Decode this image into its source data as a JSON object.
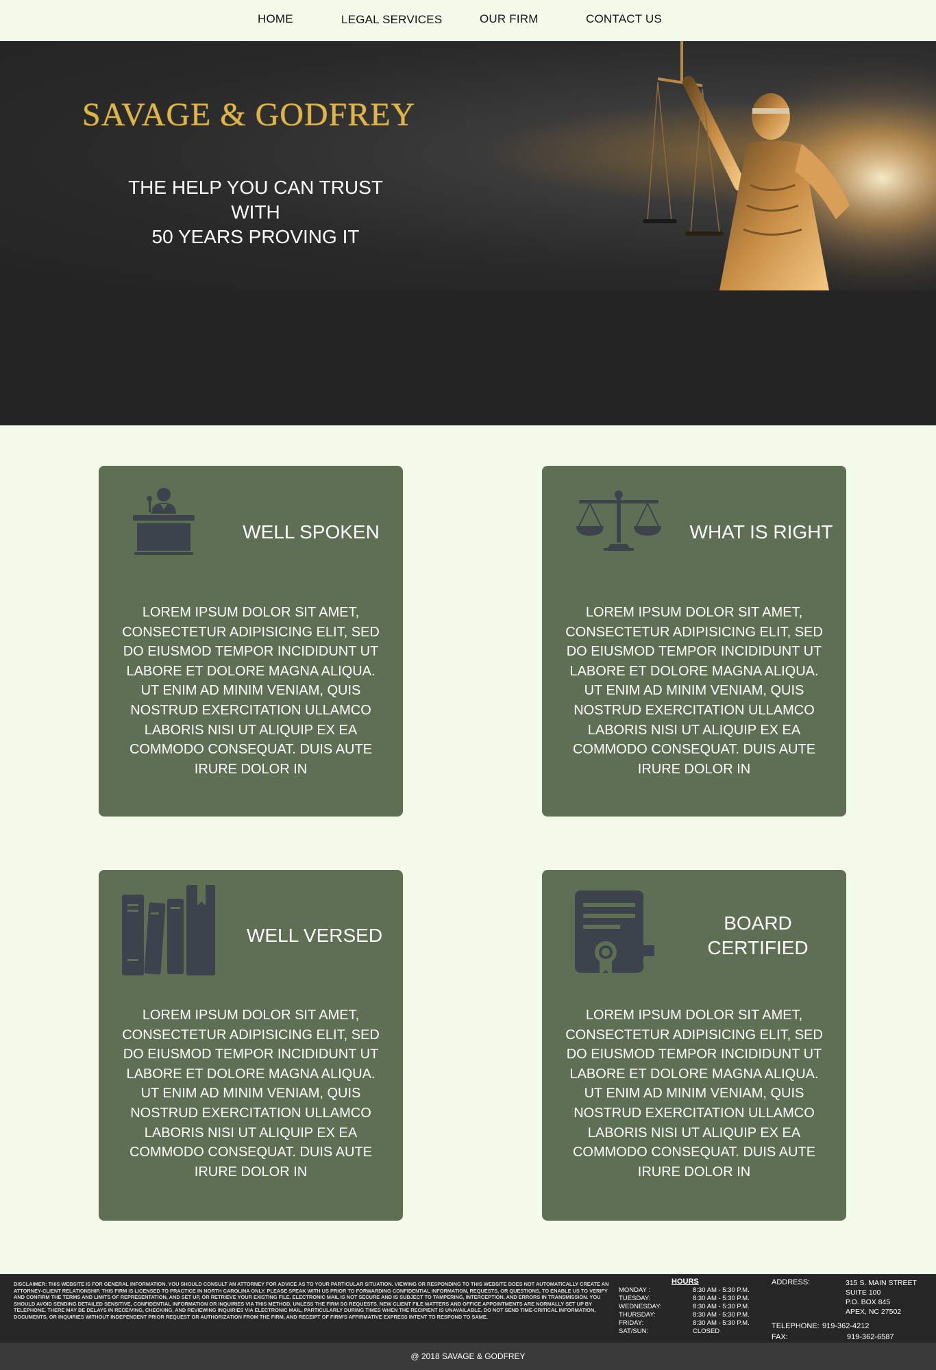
{
  "nav": {
    "home": "HOME",
    "legal_services": "LEGAL SERVICES",
    "our_firm": "OUR FIRM",
    "contact_us": "CONTACT US"
  },
  "hero": {
    "brand": "SAVAGE & GODFREY",
    "tagline_line1": "THE HELP YOU CAN TRUST",
    "tagline_line2": "WITH",
    "tagline_line3": "50 YEARS PROVING IT"
  },
  "cards": [
    {
      "title": "WELL SPOKEN",
      "icon": "podium-speaker-icon",
      "body": "LOREM IPSUM DOLOR SIT AMET, CONSECTETUR ADIPISICING ELIT, SED DO EIUSMOD TEMPOR INCIDIDUNT UT LABORE ET DOLORE MAGNA ALIQUA. UT ENIM AD MINIM VENIAM, QUIS NOSTRUD EXERCITATION ULLAMCO LABORIS NISI UT ALIQUIP EX EA COMMODO CONSEQUAT. DUIS AUTE IRURE DOLOR IN"
    },
    {
      "title": "WHAT IS RIGHT",
      "icon": "scales-icon",
      "body": "LOREM IPSUM DOLOR SIT AMET, CONSECTETUR ADIPISICING ELIT, SED DO EIUSMOD TEMPOR INCIDIDUNT UT LABORE ET DOLORE MAGNA ALIQUA. UT ENIM AD MINIM VENIAM, QUIS NOSTRUD EXERCITATION ULLAMCO LABORIS NISI UT ALIQUIP EX EA COMMODO CONSEQUAT. DUIS AUTE IRURE DOLOR IN"
    },
    {
      "title": "WELL VERSED",
      "icon": "books-icon",
      "body": "LOREM IPSUM DOLOR SIT AMET, CONSECTETUR ADIPISICING ELIT, SED DO EIUSMOD TEMPOR INCIDIDUNT UT LABORE ET DOLORE MAGNA ALIQUA. UT ENIM AD MINIM VENIAM, QUIS NOSTRUD EXERCITATION ULLAMCO LABORIS NISI UT ALIQUIP EX EA COMMODO CONSEQUAT. DUIS AUTE IRURE DOLOR IN"
    },
    {
      "title_line1": "BOARD",
      "title_line2": "CERTIFIED",
      "icon": "certificate-icon",
      "body": "LOREM IPSUM DOLOR SIT AMET, CONSECTETUR ADIPISICING ELIT, SED DO EIUSMOD TEMPOR INCIDIDUNT UT LABORE ET DOLORE MAGNA ALIQUA. UT ENIM AD MINIM VENIAM, QUIS NOSTRUD EXERCITATION ULLAMCO LABORIS NISI UT ALIQUIP EX EA COMMODO CONSEQUAT. DUIS AUTE IRURE DOLOR IN"
    }
  ],
  "footer": {
    "disclaimer": "DISCLAIMER: THIS WEBSITE IS FOR GENERAL INFORMATION. YOU SHOULD CONSULT AN ATTORNEY FOR ADVICE AS TO YOUR PARTICULAR SITUATION. VIEWING OR RESPONDING TO THIS WEBSITE DOES NOT AUTOMATICALLY CREATE AN ATTORNEY-CLIENT RELATIONSHIP. THIS FIRM IS LICENSED TO PRACTICE IN NORTH CAROLINA ONLY. PLEASE SPEAK WITH US PRIOR TO FORWARDING CONFIDENTIAL INFORMATION, REQUESTS, OR QUESTIONS, TO ENABLE US TO VERIFY AND CONFIRM THE TERMS AND LIMITS OF REPRESENTATION, AND SET UP, OR RETRIEVE YOUR EXISTING FILE. ELECTRONIC MAIL IS NOT SECURE AND IS SUBJECT TO TAMPERING, INTERCEPTION, AND ERRORS IN TRANSMISSION. YOU SHOULD AVOID SENDING DETAILED SENSITIVE, CONFIDENTIAL INFORMATION OR INQUIRIES VIA THIS METHOD, UNLESS THE FIRM SO REQUESTS. NEW CLIENT FILE MATTERS AND OFFICE APPOINTMENTS ARE NORMALLY SET UP BY TELEPHONE. THERE MAY BE DELAYS IN RECEIVING, CHECKING, AND REVIEWING INQUIRIES VIA ELECTRONIC MAIL, PARTICULARLY DURING TIMES WHEN THE RECIPIENT IS UNAVAILABLE. DO NOT SEND TIME-CRITICAL INFORMATION, DOCUMENTS, OR INQUIRIES WITHOUT INDEPENDENT PRIOR REQUEST OR AUTHORIZATION FROM THE FIRM, AND RECEIPT OF FIRM'S AFFIRMATIVE EXPRESS INTENT TO RESPOND TO SAME.",
    "hours_title": "HOURS",
    "hours": [
      {
        "day": "MONDAY :",
        "time": "8:30 AM - 5:30 P.M."
      },
      {
        "day": "TUESDAY:",
        "time": "8:30 AM - 5:30 P.M."
      },
      {
        "day": "WEDNESDAY:",
        "time": "8:30 AM - 5:30 P.M."
      },
      {
        "day": "THURSDAY:",
        "time": "8:30 AM - 5:30 P.M."
      },
      {
        "day": "FRIDAY:",
        "time": "8:30 AM - 5:30 P.M."
      },
      {
        "day": "SAT/SUN:",
        "time": "CLOSED"
      }
    ],
    "address_label": "ADDRESS:",
    "address": [
      "315 S. MAIN STREET",
      "SUITE 100",
      "P.O. BOX 845",
      "APEX, NC 27502"
    ],
    "telephone_label": "TELEPHONE:",
    "telephone": "919-362-4212",
    "fax_label": "FAX:",
    "fax": "919-362-6587",
    "copyright": "@ 2018 SAVAGE & GODFREY"
  },
  "colors": {
    "page_bg": "#f4fbea",
    "card_bg": "#5f6f53",
    "icon": "#3c434d",
    "brand_gold": "#e0b545",
    "dark": "#242424"
  }
}
